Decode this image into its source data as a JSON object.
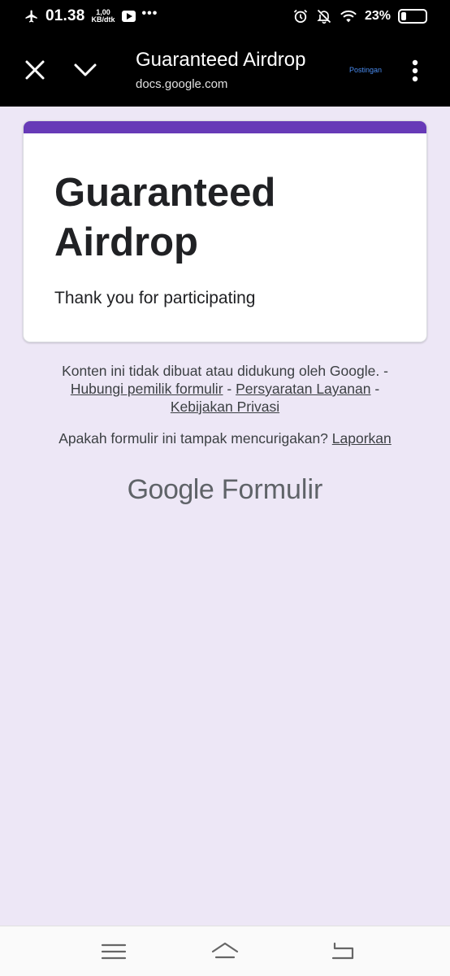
{
  "status_bar": {
    "time": "01.38",
    "speed_value": "1,00",
    "speed_unit": "KB/dtk",
    "more_dots": "•••",
    "battery_percent": "23%",
    "battery_level": 0.23
  },
  "toolbar": {
    "title": "Guaranteed Airdrop",
    "url": "docs.google.com",
    "postingan": "Postingan",
    "icons": [
      "close-icon",
      "chevron-down-icon",
      "more-vert-icon"
    ]
  },
  "card": {
    "title": "Guaranteed Airdrop",
    "message": "Thank you for participating",
    "accent_color": "#673ab7"
  },
  "footer": {
    "disclaimer": "Konten ini tidak dibuat atau didukung oleh Google.",
    "sep": "-",
    "contact_owner": "Hubungi pemilik formulir",
    "terms": "Persyaratan Layanan",
    "privacy": "Kebijakan Privasi",
    "suspicious_question": "Apakah formulir ini tampak mencurigakan?",
    "report": "Laporkan"
  },
  "brand": {
    "google": "Google",
    "product": "Formulir"
  },
  "navbar": {
    "icons": [
      "menu-icon",
      "home-icon",
      "back-icon"
    ]
  }
}
